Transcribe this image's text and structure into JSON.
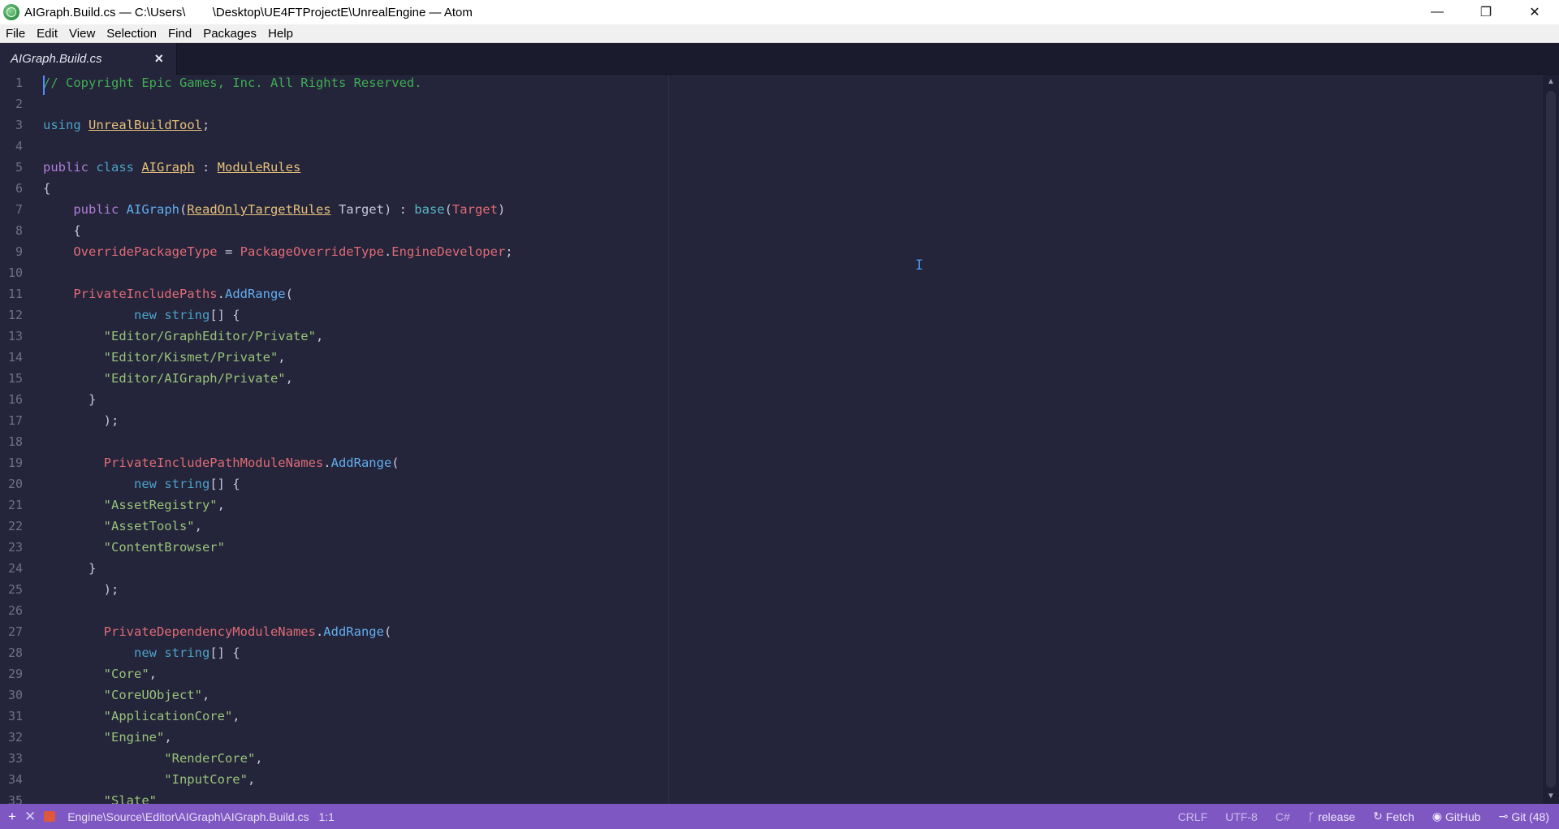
{
  "window": {
    "title": "AIGraph.Build.cs — C:\\Users\\        \\Desktop\\UE4FTProjectE\\UnrealEngine — Atom",
    "minimize": "—",
    "maximize": "❐",
    "close": "✕"
  },
  "menu": [
    "File",
    "Edit",
    "View",
    "Selection",
    "Find",
    "Packages",
    "Help"
  ],
  "tab": {
    "title": "AIGraph.Build.cs",
    "close": "×"
  },
  "code": {
    "line_numbers": [
      "1",
      "2",
      "3",
      "4",
      "5",
      "6",
      "7",
      "8",
      "9",
      "10",
      "11",
      "12",
      "13",
      "14",
      "15",
      "16",
      "17",
      "18",
      "19",
      "20",
      "21",
      "22",
      "23",
      "24",
      "25",
      "26",
      "27",
      "28",
      "29",
      "30",
      "31",
      "32",
      "33",
      "34",
      "35"
    ],
    "lines": [
      [
        {
          "t": "// Copyright Epic Games, Inc. All Rights Reserved.",
          "c": "comment"
        }
      ],
      [],
      [
        {
          "t": "using ",
          "c": "type"
        },
        {
          "t": "UnrealBuildTool",
          "c": "class"
        },
        {
          "t": ";",
          "c": "plain"
        }
      ],
      [],
      [
        {
          "t": "public ",
          "c": "kw"
        },
        {
          "t": "class ",
          "c": "type"
        },
        {
          "t": "AIGraph",
          "c": "class"
        },
        {
          "t": " : ",
          "c": "plain"
        },
        {
          "t": "ModuleRules",
          "c": "class"
        }
      ],
      [
        {
          "t": "{",
          "c": "plain"
        }
      ],
      [
        {
          "t": "    public ",
          "c": "kw"
        },
        {
          "t": "AIGraph",
          "c": "func"
        },
        {
          "t": "(",
          "c": "plain"
        },
        {
          "t": "ReadOnlyTargetRules",
          "c": "class"
        },
        {
          "t": " Target) : ",
          "c": "plain"
        },
        {
          "t": "base",
          "c": "base"
        },
        {
          "t": "(",
          "c": "plain"
        },
        {
          "t": "Target",
          "c": "prop"
        },
        {
          "t": ")",
          "c": "plain"
        }
      ],
      [
        {
          "t": "    {",
          "c": "plain"
        }
      ],
      [
        {
          "t": "    OverridePackageType",
          "c": "prop"
        },
        {
          "t": " = ",
          "c": "plain"
        },
        {
          "t": "PackageOverrideType",
          "c": "prop"
        },
        {
          "t": ".",
          "c": "plain"
        },
        {
          "t": "EngineDeveloper",
          "c": "prop"
        },
        {
          "t": ";",
          "c": "plain"
        }
      ],
      [],
      [
        {
          "t": "    PrivateIncludePaths",
          "c": "prop"
        },
        {
          "t": ".",
          "c": "plain"
        },
        {
          "t": "AddRange",
          "c": "func"
        },
        {
          "t": "(",
          "c": "plain"
        }
      ],
      [
        {
          "t": "            new ",
          "c": "type"
        },
        {
          "t": "string",
          "c": "type"
        },
        {
          "t": "[] {",
          "c": "plain"
        }
      ],
      [
        {
          "t": "        \"Editor/GraphEditor/Private\"",
          "c": "str"
        },
        {
          "t": ",",
          "c": "plain"
        }
      ],
      [
        {
          "t": "        \"Editor/Kismet/Private\"",
          "c": "str"
        },
        {
          "t": ",",
          "c": "plain"
        }
      ],
      [
        {
          "t": "        \"Editor/AIGraph/Private\"",
          "c": "str"
        },
        {
          "t": ",",
          "c": "plain"
        }
      ],
      [
        {
          "t": "      }",
          "c": "plain"
        }
      ],
      [
        {
          "t": "        );",
          "c": "plain"
        }
      ],
      [],
      [
        {
          "t": "        PrivateIncludePathModuleNames",
          "c": "prop"
        },
        {
          "t": ".",
          "c": "plain"
        },
        {
          "t": "AddRange",
          "c": "func"
        },
        {
          "t": "(",
          "c": "plain"
        }
      ],
      [
        {
          "t": "            new ",
          "c": "type"
        },
        {
          "t": "string",
          "c": "type"
        },
        {
          "t": "[] {",
          "c": "plain"
        }
      ],
      [
        {
          "t": "        \"AssetRegistry\"",
          "c": "str"
        },
        {
          "t": ",",
          "c": "plain"
        }
      ],
      [
        {
          "t": "        \"AssetTools\"",
          "c": "str"
        },
        {
          "t": ",",
          "c": "plain"
        }
      ],
      [
        {
          "t": "        \"ContentBrowser\"",
          "c": "str"
        }
      ],
      [
        {
          "t": "      }",
          "c": "plain"
        }
      ],
      [
        {
          "t": "        );",
          "c": "plain"
        }
      ],
      [],
      [
        {
          "t": "        PrivateDependencyModuleNames",
          "c": "prop"
        },
        {
          "t": ".",
          "c": "plain"
        },
        {
          "t": "AddRange",
          "c": "func"
        },
        {
          "t": "(",
          "c": "plain"
        }
      ],
      [
        {
          "t": "            new ",
          "c": "type"
        },
        {
          "t": "string",
          "c": "type"
        },
        {
          "t": "[] {",
          "c": "plain"
        }
      ],
      [
        {
          "t": "        \"Core\"",
          "c": "str"
        },
        {
          "t": ",",
          "c": "plain"
        }
      ],
      [
        {
          "t": "        \"CoreUObject\"",
          "c": "str"
        },
        {
          "t": ",",
          "c": "plain"
        }
      ],
      [
        {
          "t": "        \"ApplicationCore\"",
          "c": "str"
        },
        {
          "t": ",",
          "c": "plain"
        }
      ],
      [
        {
          "t": "        \"Engine\"",
          "c": "str"
        },
        {
          "t": ",",
          "c": "plain"
        }
      ],
      [
        {
          "t": "                \"RenderCore\"",
          "c": "str"
        },
        {
          "t": ",",
          "c": "plain"
        }
      ],
      [
        {
          "t": "                \"InputCore\"",
          "c": "str"
        },
        {
          "t": ",",
          "c": "plain"
        }
      ],
      [
        {
          "t": "        \"Slate\"",
          "c": "str"
        }
      ]
    ]
  },
  "ibeam": "I",
  "status": {
    "add": "+",
    "close": "✕",
    "path": "Engine\\Source\\Editor\\AIGraph\\AIGraph.Build.cs",
    "cursor": "1:1",
    "line_ending": "CRLF",
    "encoding": "UTF-8",
    "grammar": "C#",
    "branch_icon": "ᚴ",
    "branch": "release",
    "fetch_icon": "↻",
    "fetch": "Fetch",
    "github_icon": "◉",
    "github": "GitHub",
    "git_icon": "⊸",
    "git": "Git (48)"
  }
}
